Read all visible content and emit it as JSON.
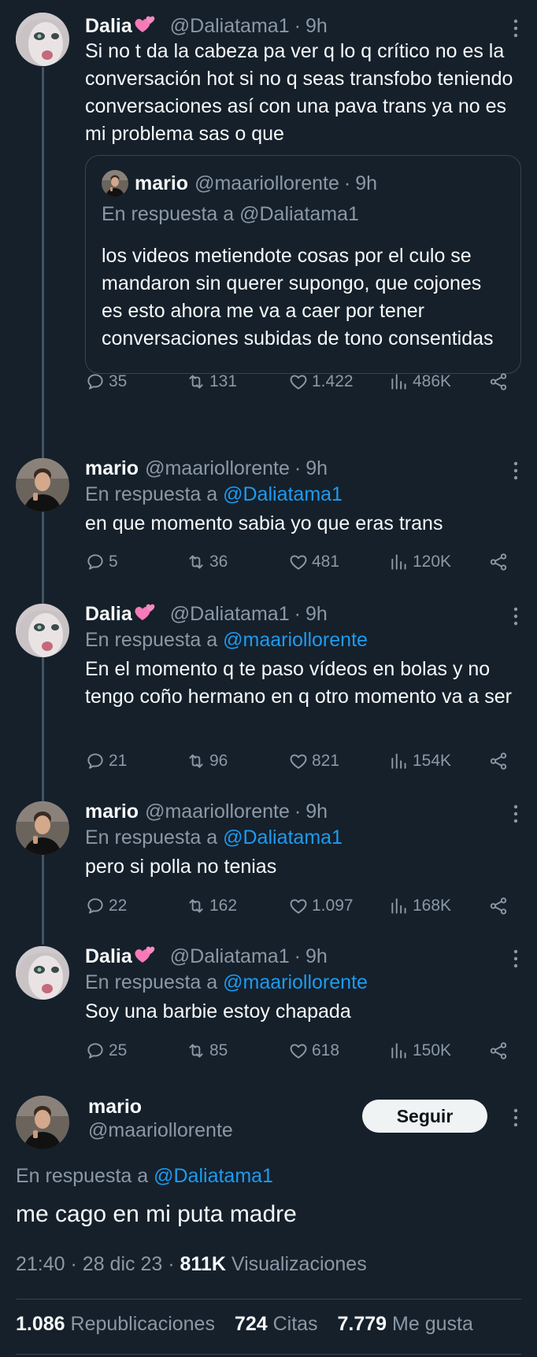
{
  "thread": [
    {
      "author": "Dalia",
      "handle": "@Daliatama1",
      "time": "9h",
      "text": "Si no t da la cabeza pa ver q lo q crítico no es la conversación hot si no q seas transfobo teniendo conversaciones así con una pava trans ya no es mi problema sas o que",
      "quote": {
        "author": "mario",
        "handle": "@maariollorente",
        "time": "9h",
        "reply_label": "En respuesta a @Daliatama1",
        "text": "los videos metiendote cosas por el culo se mandaron sin querer supongo, que cojones es esto ahora me va a caer por tener conversaciones subidas de tono consentidas"
      },
      "stats": {
        "replies": "35",
        "retweets": "131",
        "likes": "1.422",
        "views": "486K"
      }
    },
    {
      "author": "mario",
      "handle": "@maariollorente",
      "time": "9h",
      "reply_label": "En respuesta a",
      "reply_to": "@Daliatama1",
      "text": "en que momento sabia yo que eras trans",
      "stats": {
        "replies": "5",
        "retweets": "36",
        "likes": "481",
        "views": "120K"
      }
    },
    {
      "author": "Dalia",
      "handle": "@Daliatama1",
      "time": "9h",
      "reply_label": "En respuesta a",
      "reply_to": "@maariollorente",
      "text": "En el momento q te paso vídeos en bolas y no tengo coño hermano en q otro momento va a ser",
      "stats": {
        "replies": "21",
        "retweets": "96",
        "likes": "821",
        "views": "154K"
      }
    },
    {
      "author": "mario",
      "handle": "@maariollorente",
      "time": "9h",
      "reply_label": "En respuesta a",
      "reply_to": "@Daliatama1",
      "text": "pero si polla no tenias",
      "stats": {
        "replies": "22",
        "retweets": "162",
        "likes": "1.097",
        "views": "168K"
      }
    },
    {
      "author": "Dalia",
      "handle": "@Daliatama1",
      "time": "9h",
      "reply_label": "En respuesta a",
      "reply_to": "@maariollorente",
      "text": "Soy una barbie estoy chapada",
      "stats": {
        "replies": "25",
        "retweets": "85",
        "likes": "618",
        "views": "150K"
      }
    }
  ],
  "main": {
    "author": "mario",
    "handle": "@maariollorente",
    "follow_label": "Seguir",
    "reply_label": "En respuesta a",
    "reply_to": "@Daliatama1",
    "text": "me cago en mi puta madre",
    "time": "21:40",
    "date": "28 dic 23",
    "views_count": "811K",
    "views_label": "Visualizaciones",
    "reposts_count": "1.086",
    "reposts_label": "Republicaciones",
    "quotes_count": "724",
    "quotes_label": "Citas",
    "likes_count": "7.779",
    "likes_label": "Me gusta"
  },
  "colors": {
    "background": "#15202b",
    "text": "#f7f9f9",
    "secondary": "#8b98a5",
    "link": "#1d9bf0",
    "border": "#38444d"
  },
  "icons": {
    "name_emoji": "two-hearts-icon",
    "reply": "reply-icon",
    "retweet": "retweet-icon",
    "like": "heart-icon",
    "views": "views-icon",
    "share": "share-icon",
    "more": "more-icon"
  }
}
